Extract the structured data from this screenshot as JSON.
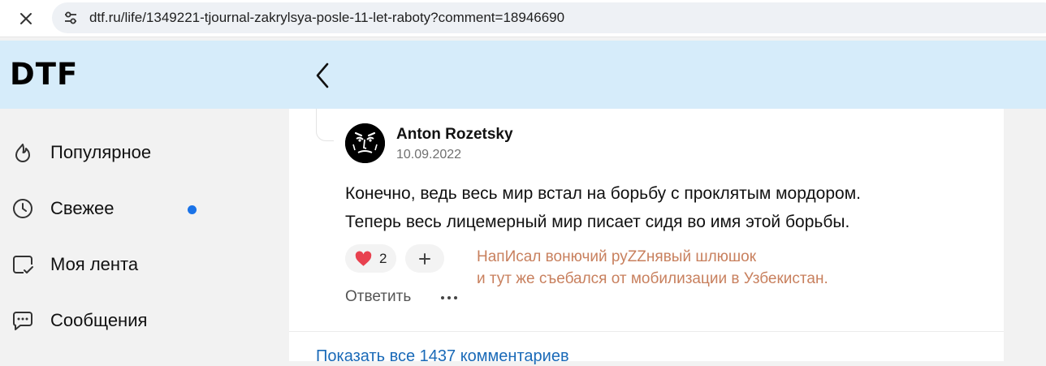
{
  "browser": {
    "url": "dtf.ru/life/1349221-tjournal-zakrylsya-posle-11-let-raboty?comment=18946690"
  },
  "header": {
    "logo": "DTF"
  },
  "sidebar": {
    "items": [
      {
        "label": "Популярное",
        "icon": "flame-icon"
      },
      {
        "label": "Свежее",
        "icon": "clock-icon",
        "unread": true
      },
      {
        "label": "Моя лента",
        "icon": "feed-check-icon"
      },
      {
        "label": "Сообщения",
        "icon": "chat-bubble-icon"
      }
    ],
    "unread_color": "#1a73e8"
  },
  "comment": {
    "author": "Anton Rozetsky",
    "date": "10.09.2022",
    "text_lines": [
      "Конечно, ведь весь мир встал на борьбу с проклятым мордором.",
      "Теперь весь лицемерный мир писает сидя во имя этой борьбы."
    ],
    "likes": "2",
    "reply_label": "Ответить",
    "note_lines": [
      "НапИсал вонючий руZZнявый шлюшок",
      "и тут же съебался от мобилизации в Узбекистан."
    ]
  },
  "footer": {
    "show_all": "Показать все 1437 комментариев"
  },
  "colors": {
    "header_bg": "#d6ecfa",
    "link": "#1a6ab8",
    "heart": "#e8414f",
    "note": "#c8805e"
  }
}
